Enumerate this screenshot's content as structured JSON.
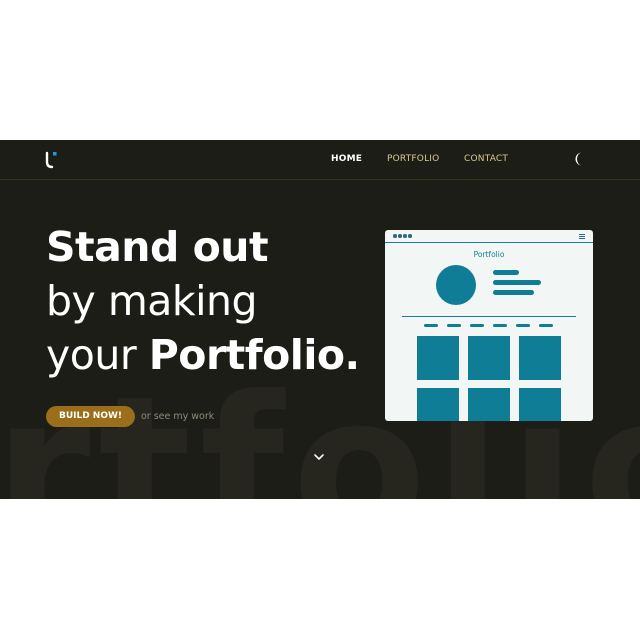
{
  "nav": {
    "links": [
      {
        "label": "HOME",
        "active": true
      },
      {
        "label": "PORTFOLIO",
        "active": false
      },
      {
        "label": "CONTACT",
        "active": false
      }
    ]
  },
  "hero": {
    "line1": "Stand out",
    "line2": "by making",
    "line3_light": "your ",
    "line3_bold": "Portfolio.",
    "cta_label": "BUILD NOW!",
    "secondary_link": "or see my work",
    "background_word": "rtfolio"
  },
  "mockup": {
    "title": "Portfolio"
  },
  "colors": {
    "hero_background": "#1d1d18",
    "accent_gold": "#9a6e1a",
    "nav_link": "#d8c98e",
    "teal": "#0f7d95",
    "logo_blue": "#1e9ad6"
  },
  "icons": {
    "logo": "brand-logo-icon",
    "theme_toggle": "moon-icon",
    "scroll_down": "chevron-down-icon"
  }
}
